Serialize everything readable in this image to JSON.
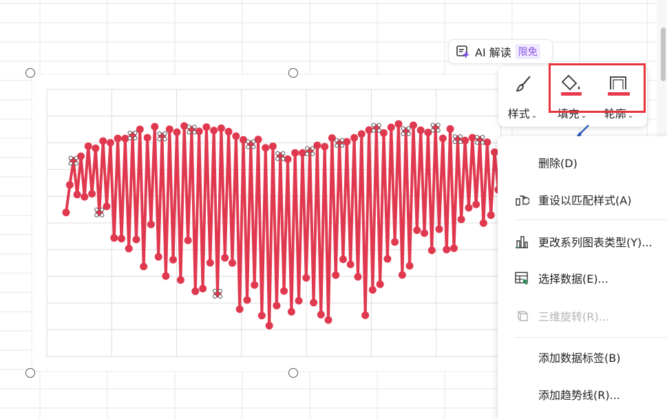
{
  "ai_pill": {
    "label": "AI 解读",
    "badge": "限免"
  },
  "toolbar": {
    "style_label": "样式",
    "fill_label": "填充",
    "outline_label": "轮廓",
    "fill_color": "#e8394d",
    "outline_color": "#e8394d"
  },
  "context_menu": {
    "items": [
      {
        "label": "删除(D)",
        "icon": "none",
        "enabled": true
      },
      {
        "label": "重设以匹配样式(A)",
        "icon": "reset-style-icon",
        "enabled": true
      },
      {
        "label": "更改系列图表类型(Y)...",
        "icon": "chart-type-icon",
        "enabled": true
      },
      {
        "label": "选择数据(E)...",
        "icon": "select-data-icon",
        "enabled": true
      },
      {
        "label": "三维旋转(R)...",
        "icon": "3d-rotate-icon",
        "enabled": false
      },
      {
        "label": "添加数据标签(B)",
        "icon": "none",
        "enabled": true
      },
      {
        "label": "添加趋势线(R)...",
        "icon": "none",
        "enabled": true
      }
    ]
  },
  "chart_data": {
    "type": "line",
    "series_color": "#e0394f",
    "marker": "circle",
    "shape": "heart",
    "zigzag_points": 120,
    "grid": true
  }
}
